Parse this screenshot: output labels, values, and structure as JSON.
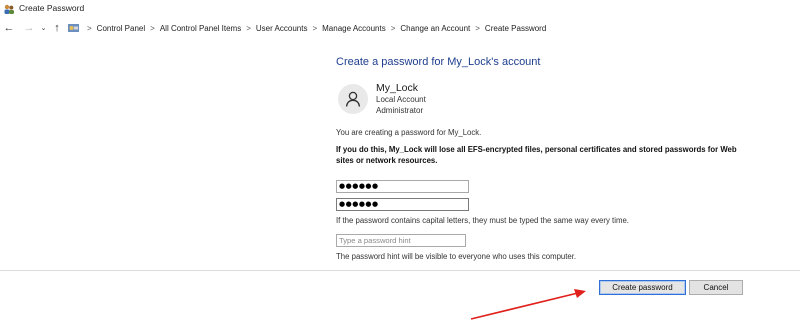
{
  "window": {
    "title": "Create Password",
    "icon": "users-icon"
  },
  "navigation": {
    "back": "←",
    "forward": "→",
    "recent": "⌄",
    "up": "↑",
    "breadcrumb": [
      "Control Panel",
      "All Control Panel Items",
      "User Accounts",
      "Manage Accounts",
      "Change an Account",
      "Create Password"
    ]
  },
  "main": {
    "heading": "Create a password for My_Lock's account",
    "user": {
      "name": "My_Lock",
      "type": "Local Account",
      "role": "Administrator"
    },
    "info": "You are creating a password for My_Lock.",
    "warning": "If you do this, My_Lock will lose all EFS-encrypted files, personal certificates and stored passwords for Web sites or network resources.",
    "new_password": "●●●●●●",
    "confirm_password": "●●●●●●",
    "caps_note": "If the password contains capital letters, they must be typed the same way every time.",
    "hint_placeholder": "Type a password hint",
    "hint_note": "The password hint will be visible to everyone who uses this computer."
  },
  "buttons": {
    "create": "Create password",
    "cancel": "Cancel"
  },
  "colors": {
    "heading": "#1e3e8e",
    "annotation_arrow": "#e0201b",
    "primary_border": "#2f6fd6"
  }
}
